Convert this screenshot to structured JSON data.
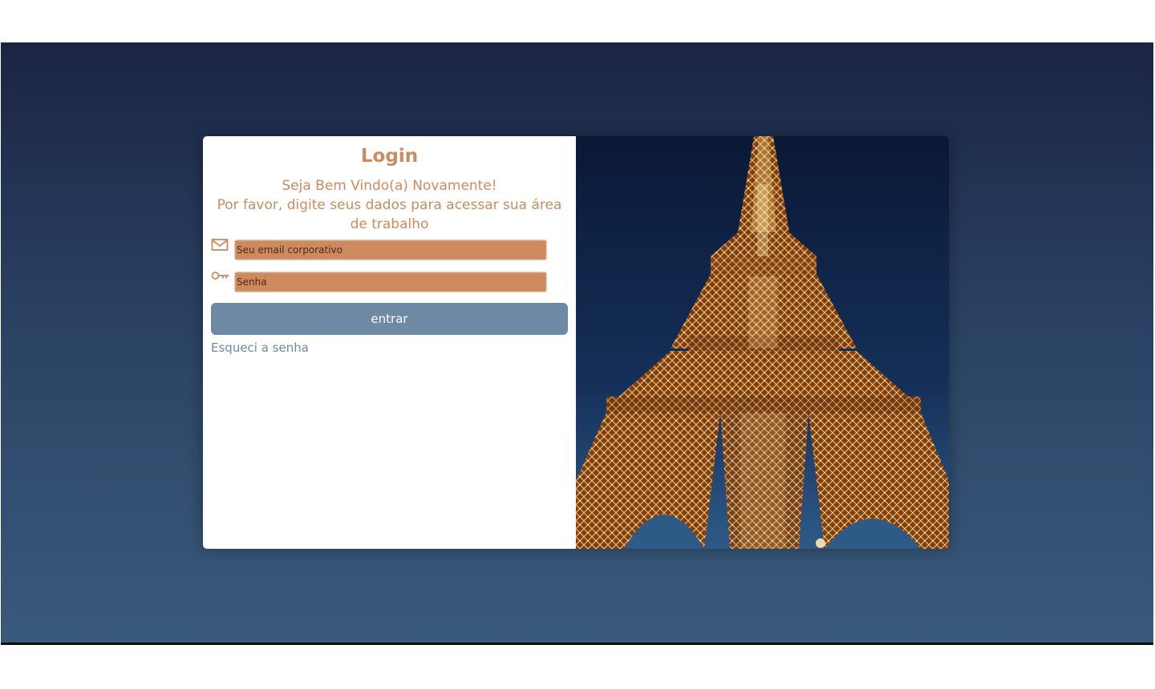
{
  "login": {
    "title": "Login",
    "welcome_line1": "Seja Bem Vindo(a) Novamente!",
    "welcome_line2": "Por favor, digite seus dados para acessar sua área de trabalho",
    "email_placeholder": "Seu email corporativo",
    "password_placeholder": "Senha",
    "email_icon": "mail-icon",
    "password_icon": "key-icon",
    "submit_label": "entrar",
    "forgot_label": "Esqueci a senha"
  },
  "hero_image": {
    "subject": "eiffel-tower-photo"
  },
  "colors": {
    "accent": "#cd8a5e",
    "button": "#6e89a3",
    "background_top": "#1b2444",
    "background_bottom": "#3a5a7c"
  }
}
